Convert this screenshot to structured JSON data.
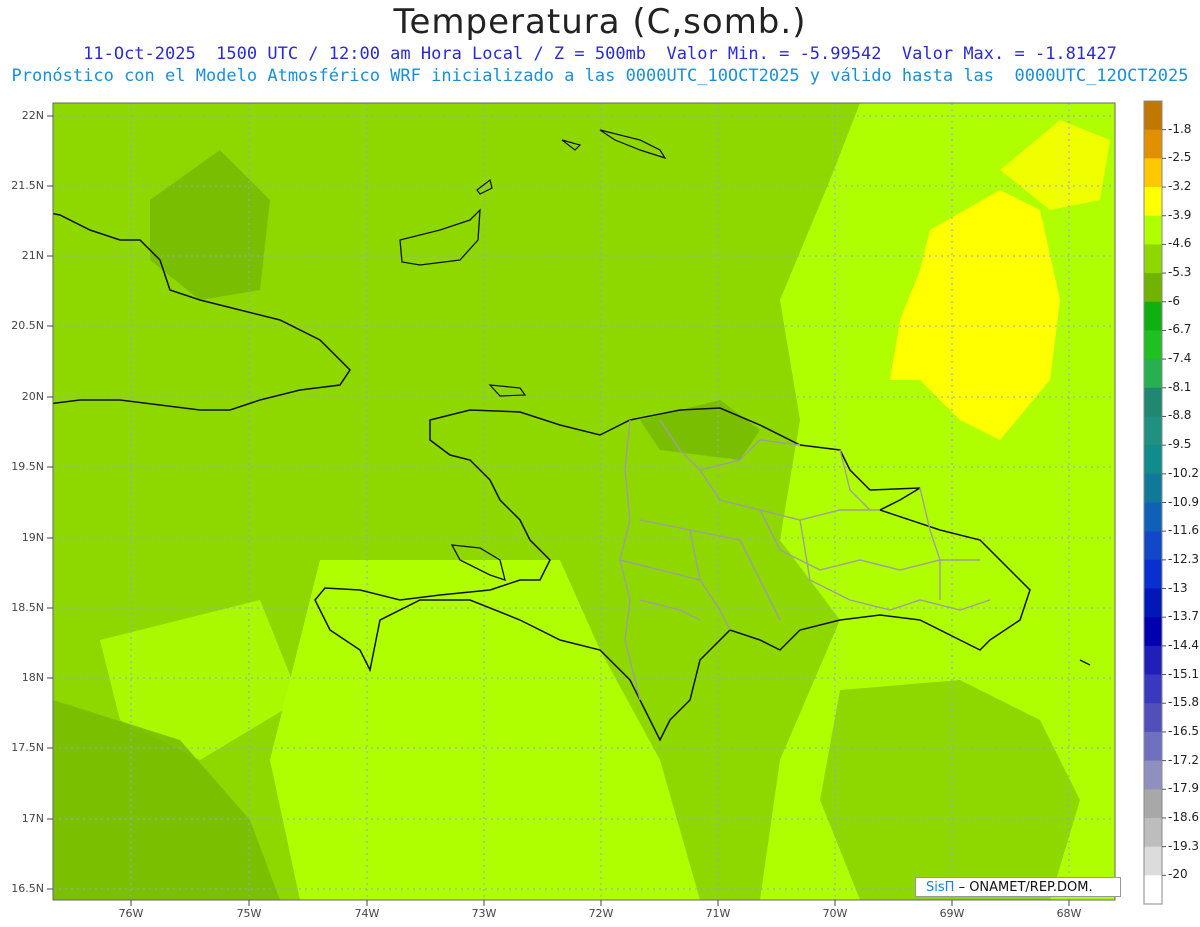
{
  "header": {
    "title": "Temperatura (C,somb.)",
    "line1": "11-Oct-2025  1500 UTC / 12:00 am Hora Local / Z = 500mb  Valor Min. = -5.99542  Valor Max. = -1.81427",
    "line2": "Pronóstico con el Modelo Atmosférico WRF inicializado a las 0000UTC_10OCT2025 y válido hasta las  0000UTC_12OCT2025"
  },
  "axes": {
    "lat_labels": [
      "22N",
      "21.5N",
      "21N",
      "20.5N",
      "20N",
      "19.5N",
      "19N",
      "18.5N",
      "18N",
      "17.5N",
      "17N",
      "16.5N"
    ],
    "lon_labels": [
      "76W",
      "75W",
      "74W",
      "73W",
      "72W",
      "71W",
      "70W",
      "69W",
      "68W"
    ]
  },
  "colorbar": {
    "labels": [
      "-1.8",
      "-2.5",
      "-3.2",
      "-3.9",
      "-4.6",
      "-5.3",
      "-6",
      "-6.7",
      "-7.4",
      "-8.1",
      "-8.8",
      "-9.5",
      "-10.2",
      "-10.9",
      "-11.6",
      "-12.3",
      "-13",
      "-13.7",
      "-14.4",
      "-15.1",
      "-15.8",
      "-16.5",
      "-17.2",
      "-17.9",
      "-18.6",
      "-19.3",
      "-20"
    ],
    "colors": [
      "#c07800",
      "#e09000",
      "#ffc800",
      "#ffff00",
      "#b0ff00",
      "#8ed800",
      "#70b400",
      "#10b010",
      "#20c020",
      "#28b050",
      "#208870",
      "#209080",
      "#108c8c",
      "#107898",
      "#1060b8",
      "#1048c8",
      "#0830d0",
      "#0018b8",
      "#0000b0",
      "#2020b8",
      "#3838c0",
      "#5050b8",
      "#7070c0",
      "#9090c0",
      "#a8a8a8",
      "#bdbdbd",
      "#dcdcdc",
      "#ffffff"
    ]
  },
  "credit": {
    "sis": "SisΠ",
    "org": "– ONAMET/REP.DOM."
  }
}
